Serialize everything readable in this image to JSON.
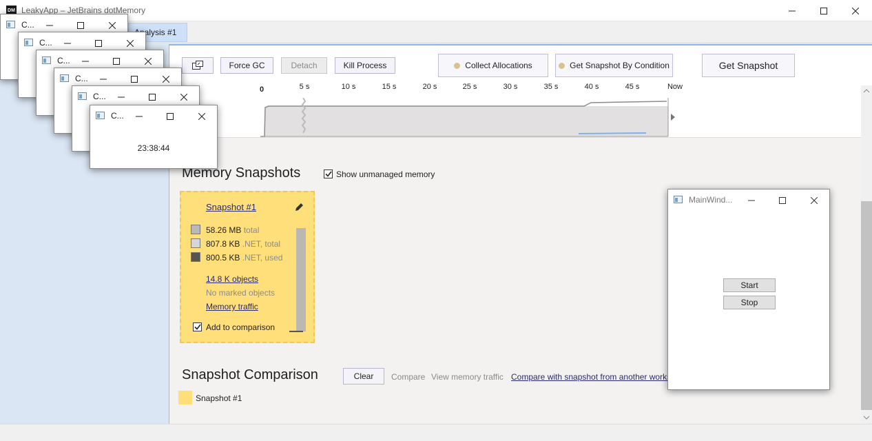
{
  "window": {
    "title": "LeakyApp – JetBrains dotMemory",
    "tab": "Analysis #1"
  },
  "toolbar": {
    "force_gc": "Force GC",
    "detach": "Detach",
    "kill_process": "Kill Process",
    "collect_allocations": "Collect Allocations",
    "get_snapshot_by_condition": "Get Snapshot By Condition",
    "get_snapshot": "Get Snapshot"
  },
  "timeline": {
    "ticks": [
      "0",
      "5 s",
      "10 s",
      "15 s",
      "20 s",
      "25 s",
      "30 s",
      "35 s",
      "40 s",
      "45 s",
      "Now"
    ]
  },
  "snapshots": {
    "heading": "Memory Snapshots",
    "show_unmanaged": "Show unmanaged memory",
    "show_unmanaged_checked": true,
    "card": {
      "name": "Snapshot #1",
      "rows": [
        {
          "value": "58.26 MB",
          "label": "total",
          "color": "#b9b9b9"
        },
        {
          "value": "807.8 KB",
          "label": ".NET, total",
          "color": "#d6d6d6"
        },
        {
          "value": "800.5 KB",
          "label": ".NET, used",
          "color": "#5a5451"
        }
      ],
      "objects": "14.8 K objects",
      "no_marked": "No marked objects",
      "memory_traffic": "Memory traffic",
      "add_to_comparison": "Add to comparison",
      "add_checked": true,
      "color": "#ffdf7a"
    }
  },
  "comparison": {
    "heading": "Snapshot Comparison",
    "clear": "Clear",
    "compare": "Compare",
    "view_memory_traffic": "View memory traffic",
    "compare_other": "Compare with snapshot from another workspace",
    "item": "Snapshot #1"
  },
  "clock_windows": {
    "short_title": "C...",
    "time": "23:38:44"
  },
  "main_window": {
    "title": "MainWind...",
    "start": "Start",
    "stop": "Stop"
  }
}
